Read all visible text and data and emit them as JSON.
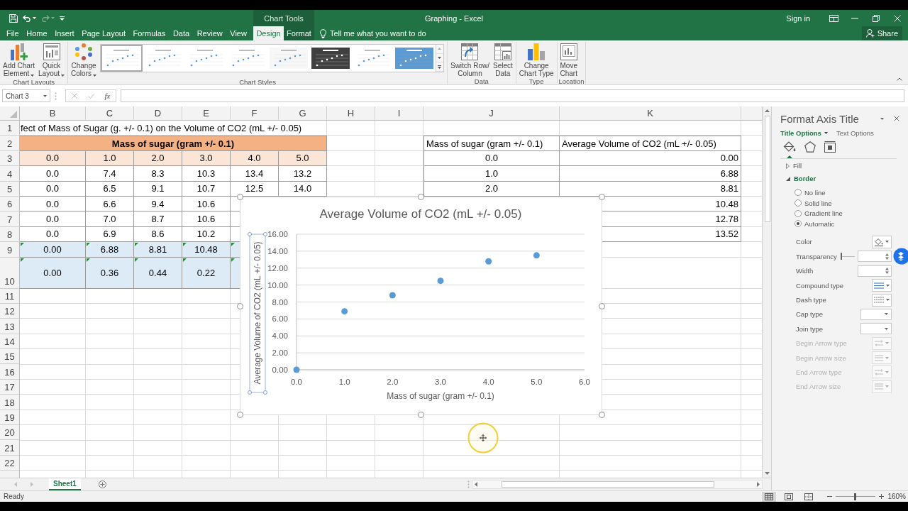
{
  "title_bar": {
    "quick_access": [
      {
        "kind": "save",
        "disabled": false
      },
      {
        "kind": "undo",
        "disabled": false
      },
      {
        "kind": "redo",
        "disabled": true
      },
      {
        "kind": "customize",
        "disabled": false
      }
    ],
    "context_label": "Chart Tools",
    "document_title": "Graphing - Excel",
    "sign_in": "Sign in"
  },
  "tabs": [
    {
      "label": "File",
      "selected": false,
      "contextual": false
    },
    {
      "label": "Home",
      "selected": false,
      "contextual": false
    },
    {
      "label": "Insert",
      "selected": false,
      "contextual": false
    },
    {
      "label": "Page Layout",
      "selected": false,
      "contextual": false
    },
    {
      "label": "Formulas",
      "selected": false,
      "contextual": false
    },
    {
      "label": "Data",
      "selected": false,
      "contextual": false
    },
    {
      "label": "Review",
      "selected": false,
      "contextual": false
    },
    {
      "label": "View",
      "selected": false,
      "contextual": false
    },
    {
      "label": "Design",
      "selected": true,
      "contextual": true
    },
    {
      "label": "Format",
      "selected": false,
      "contextual": true
    }
  ],
  "tell_me": {
    "placeholder": "Tell me what you want to do"
  },
  "share": "Share",
  "ribbon": [
    {
      "label": "Chart Layouts",
      "items": [
        {
          "kind": "add_element",
          "label": "Add Chart\nElement",
          "dropdown": true
        },
        {
          "kind": "quick_layout",
          "label": "Quick\nLayout",
          "dropdown": true
        }
      ]
    },
    {
      "label": "Chart Styles",
      "items": [
        {
          "kind": "change_colors",
          "label": "Change\nColors",
          "dropdown": true
        }
      ],
      "gallery": [
        {
          "color": "#ffffff",
          "selected": true
        },
        {
          "color": "#ffffff",
          "selected": false
        },
        {
          "color": "#ffffff",
          "selected": false
        },
        {
          "color": "#ffffff",
          "selected": false
        },
        {
          "color": "#f7f7f7",
          "selected": false
        },
        {
          "color": "#404040",
          "selected": false
        },
        {
          "color": "#ffffff",
          "selected": false
        },
        {
          "color": "#5b9bd5",
          "selected": false
        }
      ]
    },
    {
      "label": "Data",
      "items": [
        {
          "kind": "switch_row_column",
          "label": "Switch Row/\nColumn",
          "dropdown": false
        },
        {
          "kind": "select_data",
          "label": "Select\nData",
          "dropdown": false
        }
      ]
    },
    {
      "label": "Type",
      "items": [
        {
          "kind": "change_chart_type",
          "label": "Change\nChart Type",
          "dropdown": false
        }
      ]
    },
    {
      "label": "Location",
      "items": [
        {
          "kind": "move_chart",
          "label": "Move\nChart",
          "dropdown": false
        }
      ]
    }
  ],
  "formula_bar": {
    "name_box": "Chart 3",
    "buttons": [
      {
        "kind": "cancel",
        "disabled": true
      },
      {
        "kind": "enter",
        "disabled": true
      },
      {
        "kind": "function",
        "disabled": false,
        "label": "fx"
      }
    ]
  },
  "sheet": {
    "columns": [
      "B",
      "C",
      "D",
      "E",
      "F",
      "G",
      "H",
      "I",
      "J",
      "K"
    ],
    "rows": [
      "1",
      "2",
      "3",
      "4",
      "5",
      "6",
      "7",
      "8",
      "9",
      "10",
      "11",
      "12",
      "13",
      "14",
      "15",
      "16",
      "17",
      "18",
      "19",
      "20",
      "21",
      "22"
    ],
    "data_table": {
      "title": "fect of Mass of Sugar (g. +/- 0.1) on the Volume of CO2 (mL +/- 0.05)",
      "header": "Mass of sugar (gram +/- 0.1)",
      "masses": [
        "0.0",
        "1.0",
        "2.0",
        "3.0",
        "4.0",
        "5.0"
      ],
      "trials": [
        [
          "0.0",
          "7.4",
          "8.3",
          "10.3",
          "13.4",
          "13.2"
        ],
        [
          "0.0",
          "6.5",
          "9.1",
          "10.7",
          "12.5",
          "14.0"
        ],
        [
          "0.0",
          "6.6",
          "9.4",
          "10.6"
        ],
        [
          "0.0",
          "7.0",
          "8.7",
          "10.6"
        ],
        [
          "0.0",
          "6.9",
          "8.6",
          "10.2"
        ]
      ],
      "results": [
        {
          "flagged": true,
          "values": [
            "0.00",
            "6.88",
            "8.81",
            "10.48"
          ]
        },
        {
          "flagged": true,
          "values": [
            "0.00",
            "0.36",
            "0.44",
            "0.22"
          ]
        }
      ]
    },
    "summary_table": {
      "columns": [
        "Mass of sugar (gram +/- 0.1)",
        "Average Volume of CO2 (mL +/- 0.05)"
      ],
      "rows": [
        {
          "mass": "0.0",
          "average": "0.00"
        },
        {
          "mass": "1.0",
          "average": "6.88"
        },
        {
          "mass": "2.0",
          "average": "8.81"
        },
        {
          "average": "10.48"
        },
        {
          "average": "12.78"
        },
        {
          "average": "13.52"
        }
      ]
    }
  },
  "chart": {
    "selected": true,
    "axis_title_selected": true,
    "chart_data": {
      "type": "scatter",
      "title": "Average Volume of CO2 (mL +/- 0.05)",
      "xlabel": "Mass of sugar (gram +/- 0.1)",
      "ylabel": "Average Volume of CO2 (mL +/- 0.05)",
      "x": [
        0,
        1,
        2,
        3,
        4,
        5
      ],
      "series": [
        {
          "color": "#5b9bd5",
          "values": [
            0,
            6.9,
            8.8,
            10.5,
            12.8,
            13.5
          ]
        }
      ],
      "xlim": [
        0,
        6
      ],
      "ylim": [
        0,
        16
      ],
      "xticks": [
        {
          "value": 0,
          "label": "0.0"
        },
        {
          "value": 1,
          "label": "1.0"
        },
        {
          "value": 2,
          "label": "2.0"
        },
        {
          "value": 3,
          "label": "3.0"
        },
        {
          "value": 4,
          "label": "4.0"
        },
        {
          "value": 5,
          "label": "5.0"
        },
        {
          "value": 6,
          "label": "6.0"
        }
      ],
      "yticks": [
        {
          "value": 0,
          "label": "0.00"
        },
        {
          "value": 2,
          "label": "2.00"
        },
        {
          "value": 4,
          "label": "4.00"
        },
        {
          "value": 6,
          "label": "6.00"
        },
        {
          "value": 8,
          "label": "8.00"
        },
        {
          "value": 10,
          "label": "10.00"
        },
        {
          "value": 12,
          "label": "12.00"
        },
        {
          "value": 14,
          "label": "14.00"
        },
        {
          "value": 16,
          "label": "16.00"
        }
      ],
      "grid": true
    }
  },
  "format_pane": {
    "title": "Format Axis Title",
    "option_tabs": [
      {
        "label": "Title Options",
        "selected": true
      },
      {
        "label": "Text Options",
        "selected": false
      }
    ],
    "categories": [
      {
        "kind": "fill_line",
        "selected": true
      },
      {
        "kind": "effects",
        "selected": false
      },
      {
        "kind": "size_properties",
        "selected": false
      }
    ],
    "sections": [
      {
        "label": "Fill",
        "expanded": false
      },
      {
        "label": "Border",
        "expanded": true,
        "line_options": [
          {
            "label": "No line",
            "selected": false
          },
          {
            "label": "Solid line",
            "selected": false
          },
          {
            "label": "Gradient line",
            "selected": false
          },
          {
            "label": "Automatic",
            "selected": true
          }
        ],
        "properties": [
          {
            "label": "Color",
            "kind": "color",
            "disabled": false
          },
          {
            "label": "Transparency",
            "kind": "slider",
            "disabled": false,
            "level": 0
          },
          {
            "label": "Width",
            "kind": "spin",
            "disabled": false
          },
          {
            "label": "Compound type",
            "kind": "compound",
            "disabled": false
          },
          {
            "label": "Dash type",
            "kind": "dash",
            "disabled": false
          },
          {
            "label": "Cap type",
            "kind": "dropdown",
            "disabled": false
          },
          {
            "label": "Join type",
            "kind": "dropdown",
            "disabled": false
          },
          {
            "label": "Begin Arrow type",
            "kind": "arrow_type",
            "disabled": true
          },
          {
            "label": "Begin Arrow size",
            "kind": "arrow_size",
            "disabled": true
          },
          {
            "label": "End Arrow type",
            "kind": "arrow_type",
            "disabled": true
          },
          {
            "label": "End Arrow size",
            "kind": "arrow_size",
            "disabled": true
          }
        ]
      }
    ]
  },
  "sheet_tabs": [
    {
      "label": "Sheet1",
      "selected": true
    }
  ],
  "status_bar": {
    "text": "Ready",
    "views": [
      {
        "kind": "normal",
        "selected": true
      },
      {
        "kind": "page_layout",
        "selected": false
      },
      {
        "kind": "page_break",
        "selected": false
      }
    ],
    "zoom": {
      "level": 0.48,
      "reading": "160%"
    }
  }
}
